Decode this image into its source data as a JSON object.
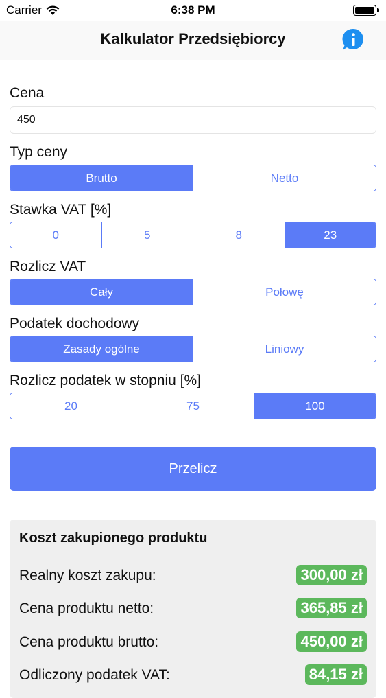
{
  "status": {
    "carrier": "Carrier",
    "time": "6:38 PM"
  },
  "nav": {
    "title": "Kalkulator Przedsiębiorcy"
  },
  "form": {
    "price_label": "Cena",
    "price_value": "450",
    "price_type": {
      "label": "Typ ceny",
      "options": [
        "Brutto",
        "Netto"
      ],
      "selected": "Brutto"
    },
    "vat_rate": {
      "label": "Stawka VAT [%]",
      "options": [
        "0",
        "5",
        "8",
        "23"
      ],
      "selected": "23"
    },
    "vat_settle": {
      "label": "Rozlicz VAT",
      "options": [
        "Cały",
        "Połowę"
      ],
      "selected": "Cały"
    },
    "income_tax": {
      "label": "Podatek dochodowy",
      "options": [
        "Zasady ogólne",
        "Liniowy"
      ],
      "selected": "Zasady ogólne"
    },
    "tax_degree": {
      "label": "Rozlicz podatek w stopniu [%]",
      "options": [
        "20",
        "75",
        "100"
      ],
      "selected": "100"
    },
    "calculate_label": "Przelicz"
  },
  "results": {
    "title": "Koszt zakupionego produktu",
    "rows": [
      {
        "label": "Realny koszt zakupu:",
        "value": "300,00 zł"
      },
      {
        "label": "Cena produktu netto:",
        "value": "365,85 zł"
      },
      {
        "label": "Cena produktu brutto:",
        "value": "450,00 zł"
      },
      {
        "label": "Odliczony podatek VAT:",
        "value": "84,15 zł"
      }
    ]
  },
  "colors": {
    "accent": "#5b7bf7",
    "badge": "#5cb85c"
  }
}
